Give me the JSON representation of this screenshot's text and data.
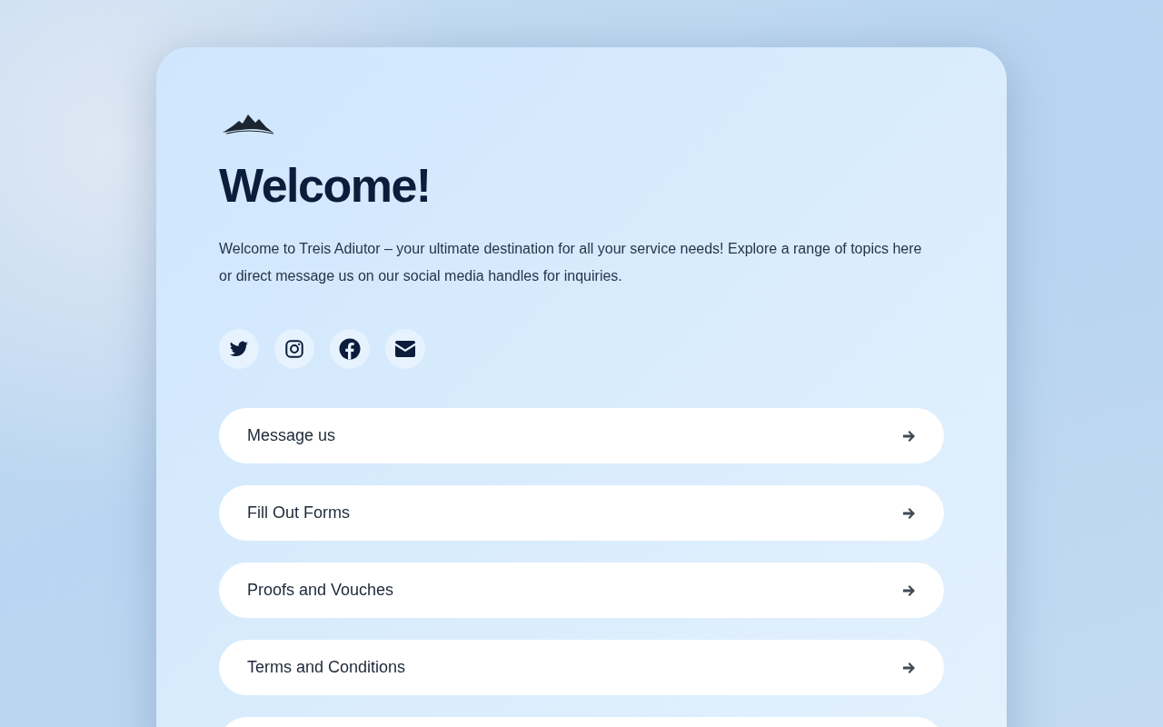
{
  "heading": "Welcome!",
  "intro": "Welcome to Treis Adiutor – your ultimate destination for all your service needs! Explore a range of topics here or direct message us on our social media handles for inquiries.",
  "social": [
    {
      "kind": "twitter"
    },
    {
      "kind": "instagram"
    },
    {
      "kind": "facebook"
    },
    {
      "kind": "email"
    }
  ],
  "links": [
    {
      "label": "Message us"
    },
    {
      "label": "Fill Out Forms"
    },
    {
      "label": "Proofs and Vouches"
    },
    {
      "label": "Terms and Conditions"
    }
  ]
}
